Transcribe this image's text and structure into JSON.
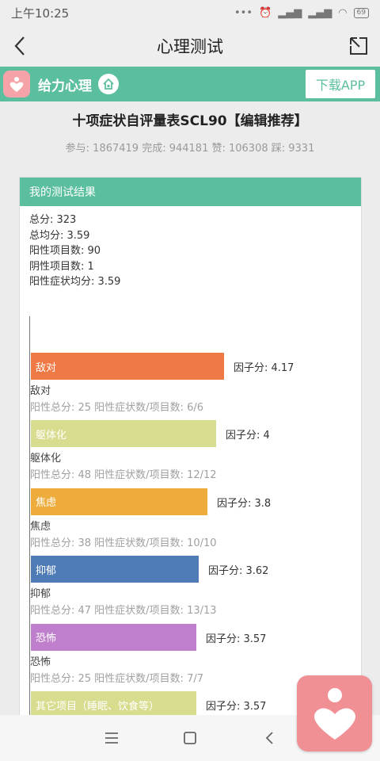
{
  "status_bar": {
    "time": "上午10:25",
    "battery": "69"
  },
  "nav": {
    "title": "心理测试"
  },
  "brand": {
    "name": "给力心理",
    "download_label": "下载APP"
  },
  "page": {
    "title": "十项症状自评量表SCL90【编辑推荐】",
    "stats": "参与: 1867419 完成: 944181 赞: 106308 踩: 9331"
  },
  "card": {
    "header": "我的测试结果",
    "summary": [
      "总分: 323",
      "总均分: 3.59",
      "阳性项目数: 90",
      "阴性项目数: 1",
      "阳性症状均分: 3.59"
    ]
  },
  "chart_data": {
    "type": "bar",
    "orientation": "horizontal",
    "categories": [
      "敌对",
      "躯体化",
      "焦虑",
      "抑郁",
      "恐怖",
      "其它项目（睡眠、饮食等）"
    ],
    "values": [
      4.17,
      4,
      3.8,
      3.62,
      3.57,
      3.57
    ],
    "colors": [
      "#ef7a45",
      "#d8dc8e",
      "#edac3c",
      "#4f7bb6",
      "#c07fcc",
      "#d8dc8e"
    ],
    "factor_labels": [
      "因子分: 4.17",
      "因子分: 4",
      "因子分: 3.8",
      "因子分: 3.62",
      "因子分: 3.57",
      "因子分: 3.57"
    ],
    "details": [
      "阳性总分: 25   阳性症状数/项目数: 6/6",
      "阳性总分: 48   阳性症状数/项目数: 12/12",
      "阳性总分: 38   阳性症状数/项目数: 10/10",
      "阳性总分: 47   阳性症状数/项目数: 13/13",
      "阳性总分: 25   阳性症状数/项目数: 7/7",
      ""
    ]
  },
  "icons": {
    "back": "chevron-left-icon",
    "share": "share-icon",
    "home": "home-icon",
    "menu": "menu-icon",
    "square": "square-icon",
    "back_nav": "back-triangle-icon",
    "logo": "heart-person-icon"
  }
}
